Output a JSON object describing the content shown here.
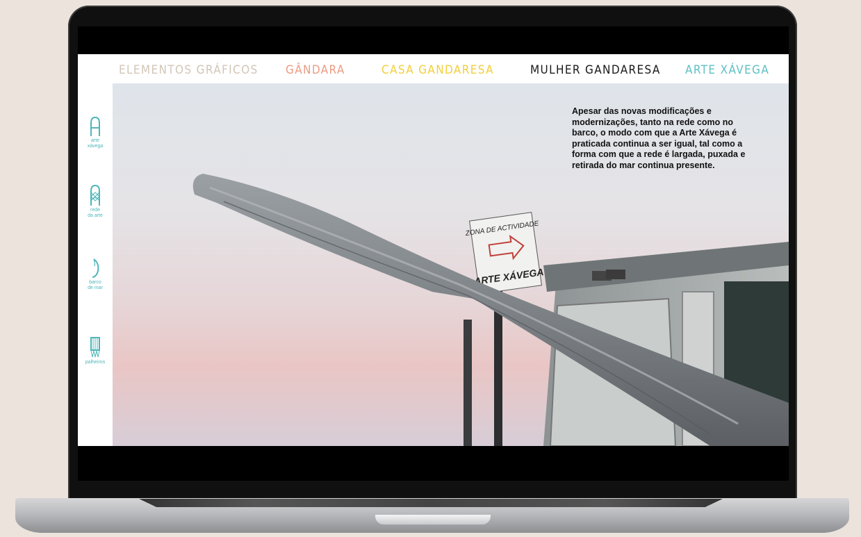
{
  "nav": {
    "items": [
      {
        "label": "ELEMENTOS GRÁFICOS",
        "color": "#d2c6b7"
      },
      {
        "label": "GÂNDARA",
        "color": "#ec9b83"
      },
      {
        "label": "CASA GANDARESA",
        "color": "#f2cf3c"
      },
      {
        "label": "MULHER GANDARESA",
        "color": "#1a1a1a"
      },
      {
        "label": "ARTE XÁVEGA",
        "color": "#5ec0c4"
      }
    ]
  },
  "sidebar": {
    "items": [
      {
        "label_line1": "arte",
        "label_line2": "xávega",
        "icon": "letter-a-icon"
      },
      {
        "label_line1": "rede",
        "label_line2": "da arte",
        "icon": "net-icon"
      },
      {
        "label_line1": "barco",
        "label_line2": "de mar",
        "icon": "boat-icon"
      },
      {
        "label_line1": "palheiros",
        "label_line2": "",
        "icon": "hut-icon"
      }
    ],
    "accent": "#4fb6ba"
  },
  "hero": {
    "paragraph": "Apesar das novas modificações e modernizações, tanto na rede como no barco, o modo com que a Arte Xávega é praticada continua a ser igual, tal como a forma com que a rede é largada, puxada e retirada do mar continua presente.",
    "sign_line1": "ZONA DE ACTIVIDADE",
    "sign_line2": "ARTE XÁVEGA"
  }
}
